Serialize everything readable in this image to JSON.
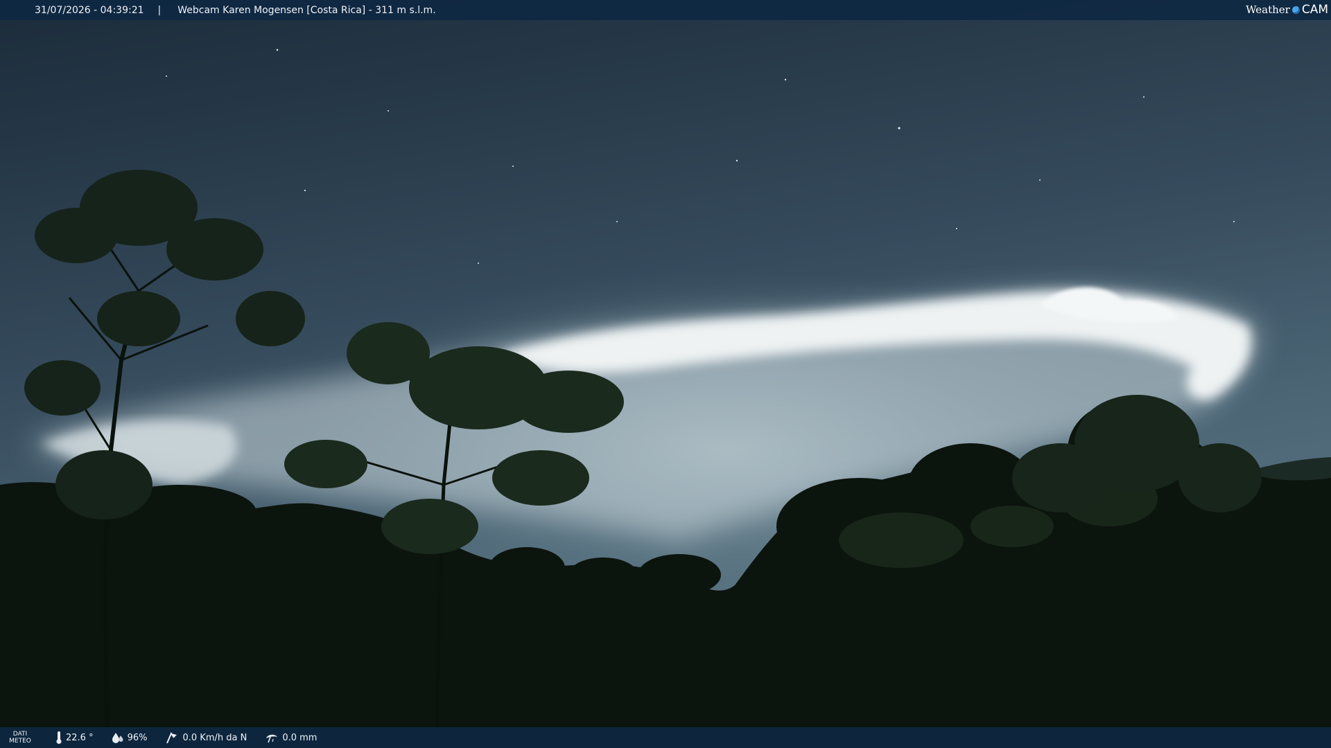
{
  "header": {
    "datetime": "31/07/2026 - 04:39:21",
    "separator": "|",
    "title": "Webcam Karen Mogensen [Costa Rica]  - 311 m s.l.m.",
    "brand_word": "Weather",
    "brand_cam": "CAM"
  },
  "footer": {
    "meteo_label_line1": "DATI",
    "meteo_label_line2": "METEO",
    "temperature": "22.6 °",
    "humidity": "96%",
    "wind": "0.0 Km/h da N",
    "rain": "0.0 mm"
  },
  "icons": [
    "thermometer-icon",
    "humidity-icon",
    "wind-icon",
    "rain-icon",
    "weathercam-logo-icon"
  ],
  "colors": {
    "bar_background": "#0e2842",
    "sky_top": "#1c2d3c",
    "sky_mid": "#3e5668",
    "cloud": "#e6ecef",
    "foliage": "#0d150f"
  }
}
